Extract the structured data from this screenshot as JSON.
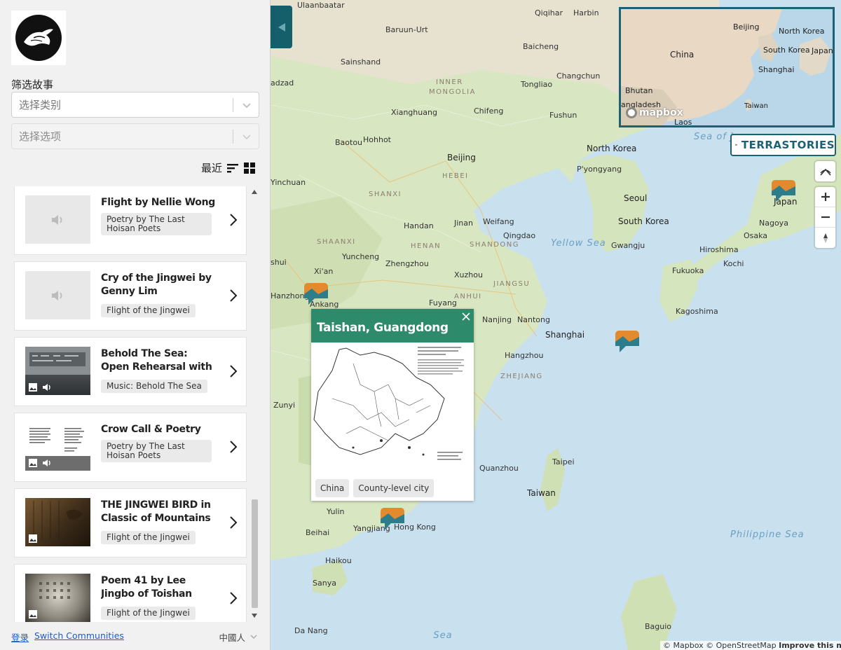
{
  "sidebar": {
    "filter_title": "筛选故事",
    "category_placeholder": "选择类别",
    "option_placeholder": "选择选项",
    "sort_label": "最近",
    "stories": [
      {
        "title": "Flight by Nellie Wong",
        "chip": "Poetry by The Last Hoisan Poets",
        "media": [
          "audio"
        ]
      },
      {
        "title": "Cry of the Jingwei by Genny Lim",
        "chip": "Flight of the Jingwei",
        "media": [
          "audio"
        ]
      },
      {
        "title": "Behold The Sea: Open Rehearsal with Erika Ob...",
        "chip": "Music: Behold The Sea",
        "media": [
          "image",
          "audio"
        ]
      },
      {
        "title": "Crow Call & Poetry",
        "chip": "Poetry by The Last Hoisan Poets",
        "media": [
          "image",
          "audio"
        ]
      },
      {
        "title": "THE JINGWEI BIRD in Classic of Mountains an...",
        "chip": "Flight of the Jingwei",
        "media": [
          "image"
        ]
      },
      {
        "title": "Poem 41 by Lee Jingbo of Toishan",
        "chip": "Flight of the Jingwei",
        "media": [
          "image"
        ]
      }
    ],
    "footer": {
      "login": "登录",
      "switch": "Switch Communities",
      "language": "中國人"
    }
  },
  "map": {
    "popup": {
      "title": "Taishan, Guangdong",
      "tags": [
        "China",
        "County-level city"
      ]
    },
    "brand": "TERRASTORIES",
    "minimap_logo": "mapbox",
    "attribution": {
      "mapbox": "© Mapbox",
      "osm": "© OpenStreetMap",
      "improve": "Improve this map"
    },
    "labels": {
      "cities": [
        "Ulaanbaatar",
        "Qiqihar",
        "Harbin",
        "Baruun-Urt",
        "Baicheng",
        "Sainshand",
        "Changchun",
        "Tongliao",
        "Xianghuang",
        "Chifeng",
        "Fushun",
        "Hohhot",
        "Baotou",
        "Beijing",
        "Yinchuan",
        "P'yongyang",
        "Seoul",
        "Gwangju",
        "Handan",
        "Jinan",
        "Weifang",
        "Qingdao",
        "Yuncheng",
        "Zhengzhou",
        "Xuzhou",
        "Xi'an",
        "Hanzhong",
        "Ankang",
        "Fuyang",
        "Nanjing",
        "Nantong",
        "Shanghai",
        "Hangzhou",
        "Zunyi",
        "Quanzhou",
        "Taipei",
        "Taiwan",
        "Yulin",
        "Yangjiang",
        "Hong Kong",
        "Beihai",
        "Haikou",
        "Sanya",
        "Da Nang",
        "Baguio",
        "Japan",
        "Nagoya",
        "Osaka",
        "Kochi",
        "Hiroshima",
        "Fukuoka",
        "Kagoshima",
        "South Korea",
        "North Korea",
        "adzad",
        "shui"
      ],
      "regions": [
        "INNER",
        "MONGOLIA",
        "HEBEI",
        "SHANXI",
        "SHAANXI",
        "SHANDONG",
        "HENAN",
        "ANHUI",
        "JIANGSU",
        "ZHEJIANG"
      ],
      "seas": [
        "Yellow Sea",
        "Philippine Sea",
        "Sea of Japan",
        "Sea"
      ]
    },
    "minimap_labels": [
      "Beijing",
      "North Korea",
      "South Korea",
      "Japan",
      "China",
      "Shanghai",
      "Bhutan",
      "angladesh",
      "Taiwan",
      "Laos"
    ]
  }
}
